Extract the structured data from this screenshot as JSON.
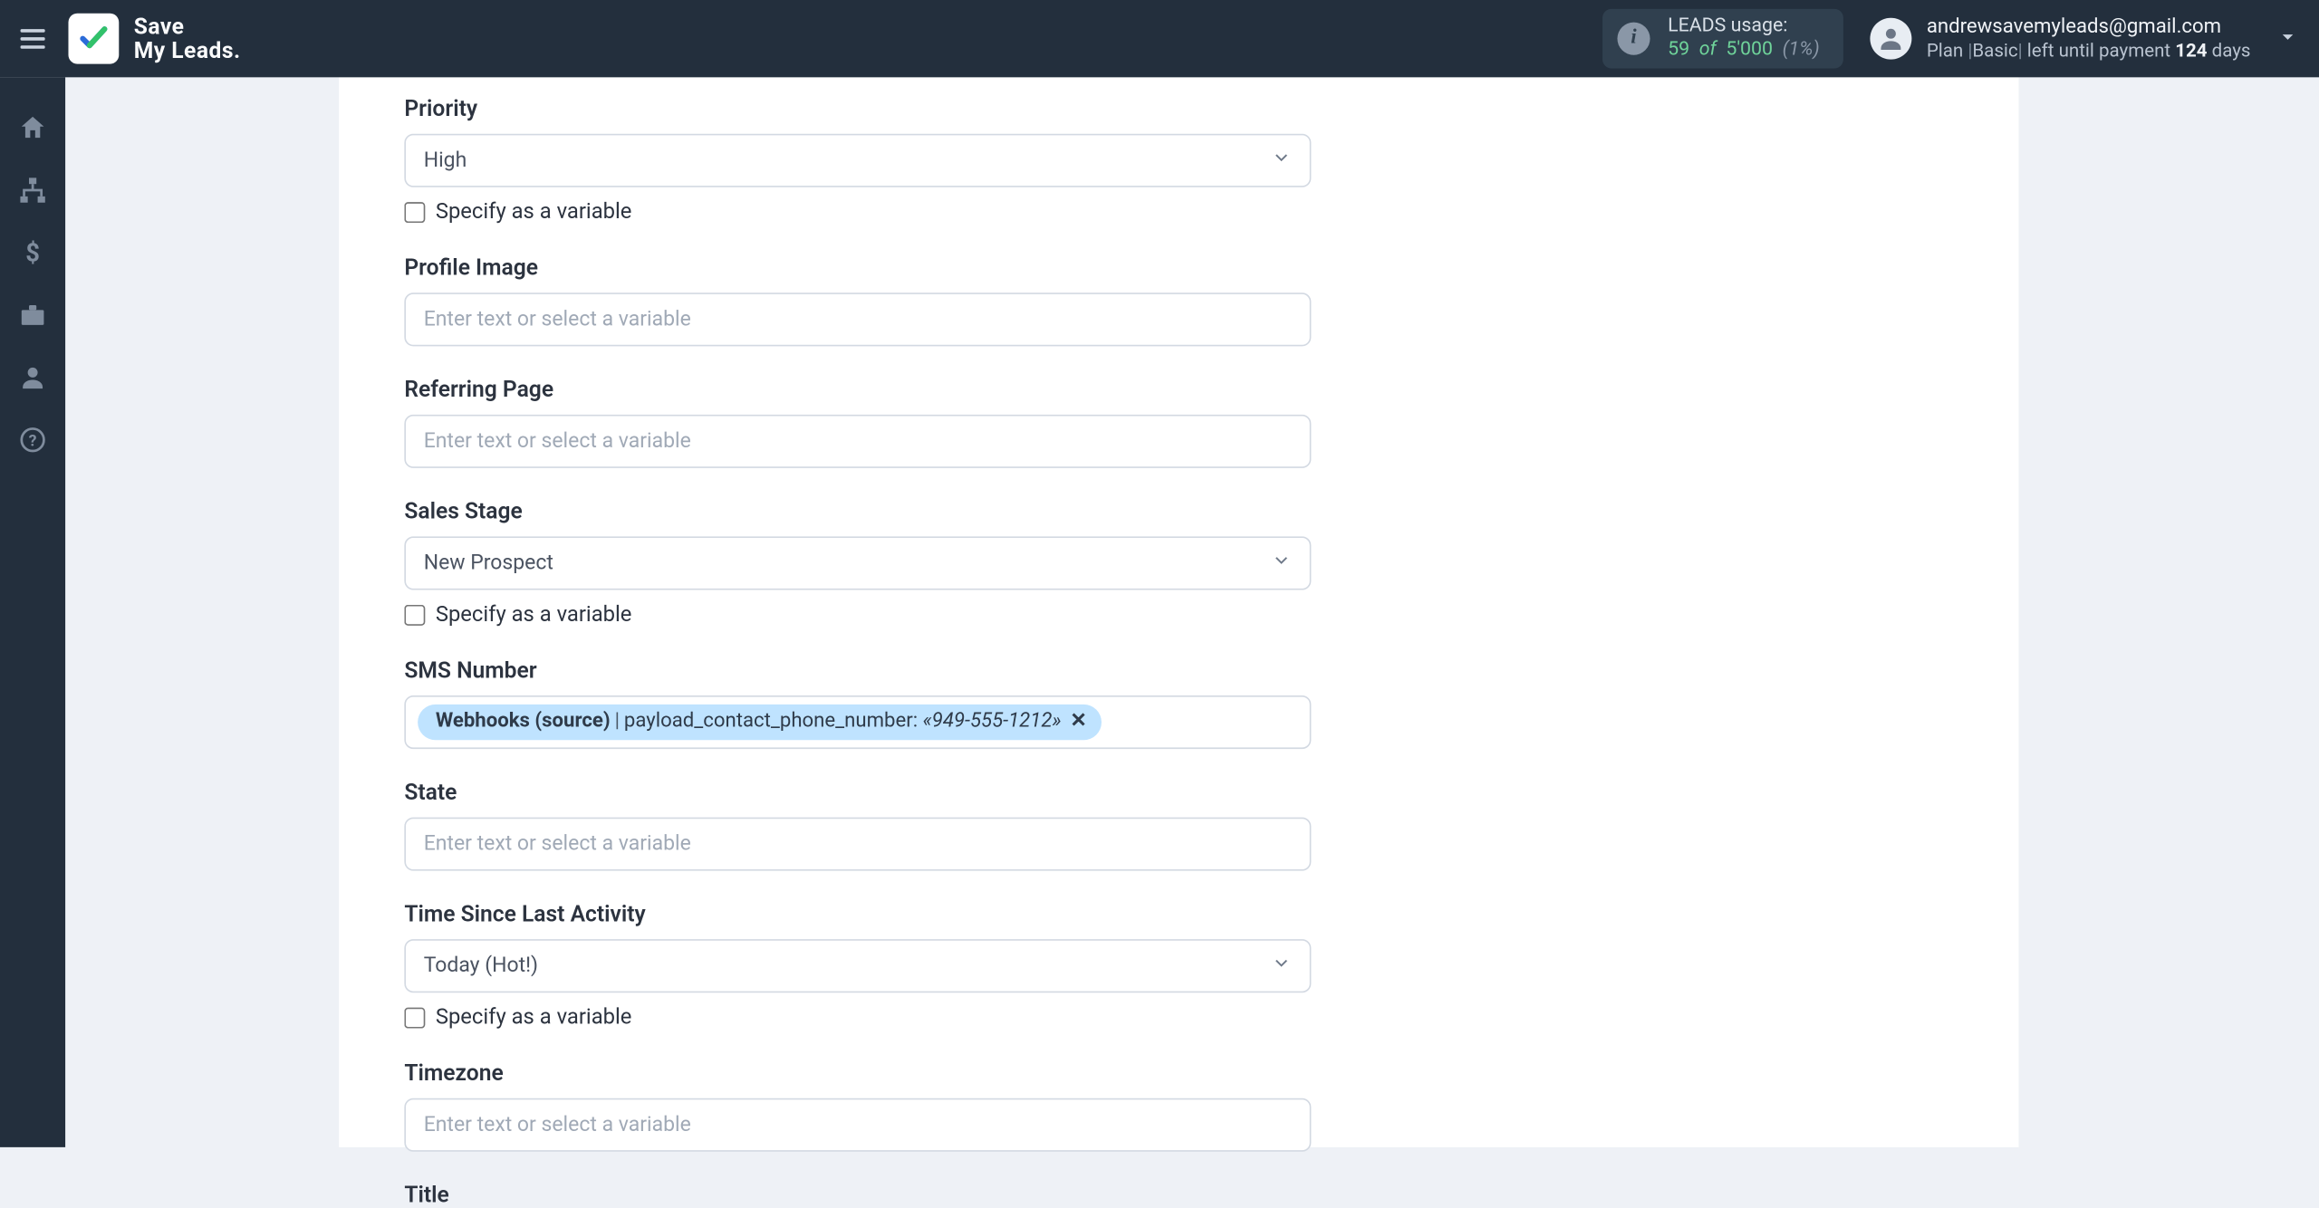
{
  "brand": {
    "line1": "Save",
    "line2": "My Leads."
  },
  "header": {
    "usage": {
      "label": "LEADS usage:",
      "used": "59",
      "of_word": "of",
      "total": "5'000",
      "percent": "(1%)"
    },
    "account": {
      "email": "andrewsavemyleads@gmail.com",
      "plan_label_prefix": "Plan",
      "plan_name": "Basic",
      "left_label": "left until payment",
      "days_number": "124",
      "days_word": "days"
    }
  },
  "sidebar": {
    "items": [
      {
        "name": "home-icon"
      },
      {
        "name": "sitemap-icon"
      },
      {
        "name": "dollar-icon"
      },
      {
        "name": "briefcase-icon"
      },
      {
        "name": "user-icon"
      },
      {
        "name": "help-icon"
      }
    ]
  },
  "form": {
    "placeholder": "Enter text or select a variable",
    "specify_variable_label": "Specify as a variable",
    "fields": {
      "priority": {
        "label": "Priority",
        "value": "High",
        "has_checkbox": true
      },
      "profile_img": {
        "label": "Profile Image",
        "value": "",
        "has_checkbox": false
      },
      "referring": {
        "label": "Referring Page",
        "value": "",
        "has_checkbox": false
      },
      "sales_stage": {
        "label": "Sales Stage",
        "value": "New Prospect",
        "has_checkbox": true
      },
      "sms": {
        "label": "SMS Number",
        "token": {
          "source": "Webhooks (source)",
          "key": "payload_contact_phone_number:",
          "value": "«949-555-1212»"
        }
      },
      "state": {
        "label": "State",
        "value": "",
        "has_checkbox": false
      },
      "time_since": {
        "label": "Time Since Last Activity",
        "value": "Today (Hot!)",
        "has_checkbox": true
      },
      "timezone": {
        "label": "Timezone",
        "value": "",
        "has_checkbox": false
      },
      "title": {
        "label": "Title"
      }
    }
  }
}
